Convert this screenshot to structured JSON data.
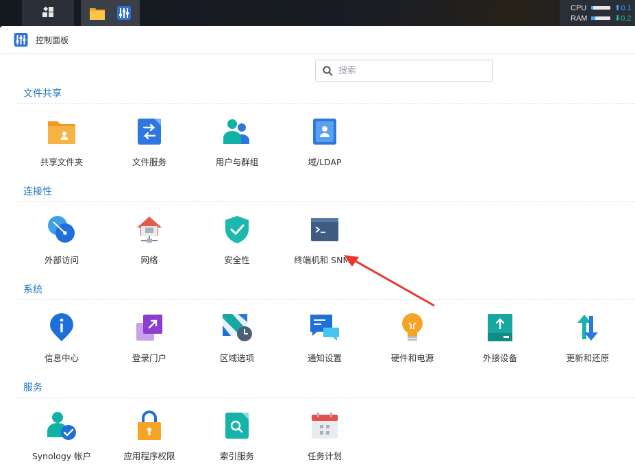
{
  "taskbar": {
    "resources": [
      {
        "label": "CPU",
        "value": "0.1",
        "fill": 0.1,
        "dir": "up"
      },
      {
        "label": "RAM",
        "value": "0.2",
        "fill": 0.2,
        "dir": "down"
      }
    ]
  },
  "window": {
    "title": "控制面板",
    "search_placeholder": "搜索"
  },
  "sections": [
    {
      "title": "文件共享",
      "items": [
        {
          "label": "共享文件夹",
          "icon": "shared-folder-icon"
        },
        {
          "label": "文件服务",
          "icon": "file-services-icon"
        },
        {
          "label": "用户与群组",
          "icon": "user-group-icon"
        },
        {
          "label": "域/LDAP",
          "icon": "domain-ldap-icon"
        }
      ]
    },
    {
      "title": "连接性",
      "items": [
        {
          "label": "外部访问",
          "icon": "external-access-icon"
        },
        {
          "label": "网络",
          "icon": "network-icon"
        },
        {
          "label": "安全性",
          "icon": "security-icon"
        },
        {
          "label": "终端机和 SNMP",
          "icon": "terminal-icon"
        }
      ]
    },
    {
      "title": "系统",
      "items": [
        {
          "label": "信息中心",
          "icon": "info-center-icon"
        },
        {
          "label": "登录门户",
          "icon": "login-portal-icon"
        },
        {
          "label": "区域选项",
          "icon": "regional-options-icon"
        },
        {
          "label": "通知设置",
          "icon": "notification-icon"
        },
        {
          "label": "硬件和电源",
          "icon": "hardware-power-icon"
        },
        {
          "label": "外接设备",
          "icon": "external-devices-icon"
        },
        {
          "label": "更新和还原",
          "icon": "update-restore-icon"
        }
      ]
    },
    {
      "title": "服务",
      "items": [
        {
          "label": "Synology 帐户",
          "icon": "synology-account-icon"
        },
        {
          "label": "应用程序权限",
          "icon": "app-privileges-icon"
        },
        {
          "label": "索引服务",
          "icon": "indexing-service-icon"
        },
        {
          "label": "任务计划",
          "icon": "task-scheduler-icon"
        }
      ]
    }
  ],
  "annotation": {
    "color": "#e8372f"
  }
}
